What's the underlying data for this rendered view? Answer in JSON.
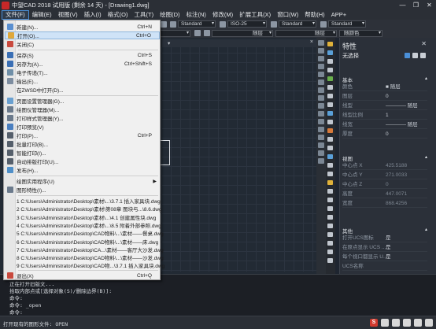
{
  "window": {
    "title": "中望CAD 2018 试用版 (剩余 14 天) - [Drawing1.dwg]",
    "controls": [
      "—",
      "❐",
      "✕"
    ]
  },
  "menubar": {
    "items": [
      "文件(F)",
      "编辑(E)",
      "视图(V)",
      "插入(I)",
      "格式(O)",
      "工具(T)",
      "绘图(D)",
      "标注(N)",
      "修改(M)",
      "扩展工具(X)",
      "窗口(W)",
      "帮助(H)",
      "APP+"
    ]
  },
  "toolbar": {
    "style1": "Standard",
    "style2": "ISO-25",
    "style3": "Standard",
    "style4": "Standard",
    "layer_left": "随层",
    "layer_mid": "随层",
    "color": "随颜色"
  },
  "drawing_tab": {
    "close": "×"
  },
  "file_menu": {
    "items": [
      {
        "label": "新建(N)...",
        "shortcut": "Ctrl+N",
        "icon": "new-file-icon",
        "color": "#5a8fd0"
      },
      {
        "label": "打开(O)...",
        "shortcut": "Ctrl+O",
        "icon": "open-folder-icon",
        "color": "#e0a83a"
      },
      {
        "label": "关闭(C)",
        "shortcut": "",
        "icon": "close-file-icon",
        "color": "#c94a3e"
      },
      {
        "label": "保存(S)",
        "shortcut": "Ctrl+S",
        "icon": "save-icon",
        "color": "#3a6fb5"
      },
      {
        "label": "另存为(A)...",
        "shortcut": "Ctrl+Shift+S",
        "icon": "save-as-icon",
        "color": "#3a6fb5"
      },
      {
        "label": "电子传递(T)...",
        "shortcut": "",
        "icon": "etransmit-icon",
        "color": "#6f8fa8"
      },
      {
        "label": "输出(E)...",
        "shortcut": "",
        "icon": "export-icon",
        "color": "#7d8da0"
      },
      {
        "label": "在ZWSD中打开(D)...",
        "shortcut": "",
        "icon": "",
        "color": ""
      },
      {
        "label": "页面设置管理器(G)...",
        "shortcut": "",
        "icon": "page-setup-icon",
        "color": "#6aa0d0"
      },
      {
        "label": "绘图仪管理器(M)...",
        "shortcut": "",
        "icon": "plotter-icon",
        "color": "#6b7a8c"
      },
      {
        "label": "打印样式管理器(Y)...",
        "shortcut": "",
        "icon": "plot-style-icon",
        "color": "#6b7a8c"
      },
      {
        "label": "打印预览(V)",
        "shortcut": "",
        "icon": "preview-icon",
        "color": "#4a7fc0"
      },
      {
        "label": "打印(P)...",
        "shortcut": "Ctrl+P",
        "icon": "print-icon",
        "color": "#555f6b"
      },
      {
        "label": "批量打印(B)...",
        "shortcut": "",
        "icon": "batch-print-icon",
        "color": "#555f6b"
      },
      {
        "label": "智能打印(I)...",
        "shortcut": "",
        "icon": "smart-print-icon",
        "color": "#555f6b"
      },
      {
        "label": "自动排版打印(U)...",
        "shortcut": "",
        "icon": "auto-layout-print-icon",
        "color": "#555f6b"
      },
      {
        "label": "发布(H)...",
        "shortcut": "",
        "icon": "publish-icon",
        "color": "#4f8fc8"
      },
      {
        "label": "绘图实用程序(U)",
        "shortcut": "",
        "icon": "",
        "color": "",
        "submenu": true
      },
      {
        "label": "图形特性(I)...",
        "shortcut": "",
        "icon": "drawing-props-icon",
        "color": "#6b7a8c"
      }
    ],
    "recent": [
      "1 C:\\Users\\Administrator\\Desktop\\素材\\...\\3.7.1 插入家具块.dwg",
      "2 C:\\Users\\Administrator\\Desktop\\素材\\第08章 图块与...\\8.6.dwg",
      "3 C:\\Users\\Administrator\\Desktop\\素材\\...\\4.1 创建属性块.dwg",
      "4 C:\\Users\\Administrator\\Desktop\\素材\\...\\8.5 附着外部参照.dwg",
      "5 C:\\Users\\Administrator\\Desktop\\CAD物料\\...\\素材——餐桌.dwg",
      "6 C:\\Users\\Administrator\\Desktop\\CAD物料\\...\\素材——床.dwg",
      "7 C:\\Users\\Administrator\\Desktop\\CA...\\素材——客厅大沙发.dwg",
      "8 C:\\Users\\Administrator\\Desktop\\CAD物料\\...\\素材——沙发.dwg",
      "9 C:\\Users\\Administrator\\Desktop\\CAD物...\\3.7.1 插入家具块.dwg"
    ],
    "exit": {
      "label": "退出(X)",
      "shortcut": "Ctrl+Q",
      "icon": "exit-icon",
      "color": "#c94a3e"
    }
  },
  "properties": {
    "title": "特性",
    "close": "✕",
    "selection": "无选择",
    "sections": {
      "basic": "基本",
      "view": "视图",
      "misc": "其他"
    },
    "basic_rows": [
      {
        "label": "颜色",
        "value": "■ 随层"
      },
      {
        "label": "图层",
        "value": "0"
      },
      {
        "label": "线型",
        "value": "———— 随层"
      },
      {
        "label": "线型比例",
        "value": "1"
      },
      {
        "label": "线宽",
        "value": "———— 随层"
      },
      {
        "label": "厚度",
        "value": "0"
      }
    ],
    "view_rows": [
      {
        "label": "中心点 X",
        "value": "425.5188"
      },
      {
        "label": "中心点 Y",
        "value": "271.0033"
      },
      {
        "label": "中心点 Z",
        "value": "0"
      },
      {
        "label": "高度",
        "value": "447.0071"
      },
      {
        "label": "宽度",
        "value": "868.4256"
      }
    ],
    "misc_rows": [
      {
        "label": "打开UCS图标",
        "value": "是"
      },
      {
        "label": "在原点显示 UCS ...",
        "value": "是"
      },
      {
        "label": "每个视口都显示 U...",
        "value": "是"
      },
      {
        "label": "UCS名称",
        "value": ""
      }
    ]
  },
  "command": {
    "lines": [
      "正在打开旧版文...",
      "拾取内部点或[选择对象(S)/删除边界(B)]:",
      "命令:",
      "命令: _open",
      "命令:"
    ],
    "prompt": "打开现有的图形文件: OPEN"
  },
  "colors": {
    "accent": "#4a8fd8",
    "menu_bg": "#f0f0f0",
    "panel_bg": "#2b3039",
    "canvas_bg": "#222a34"
  }
}
